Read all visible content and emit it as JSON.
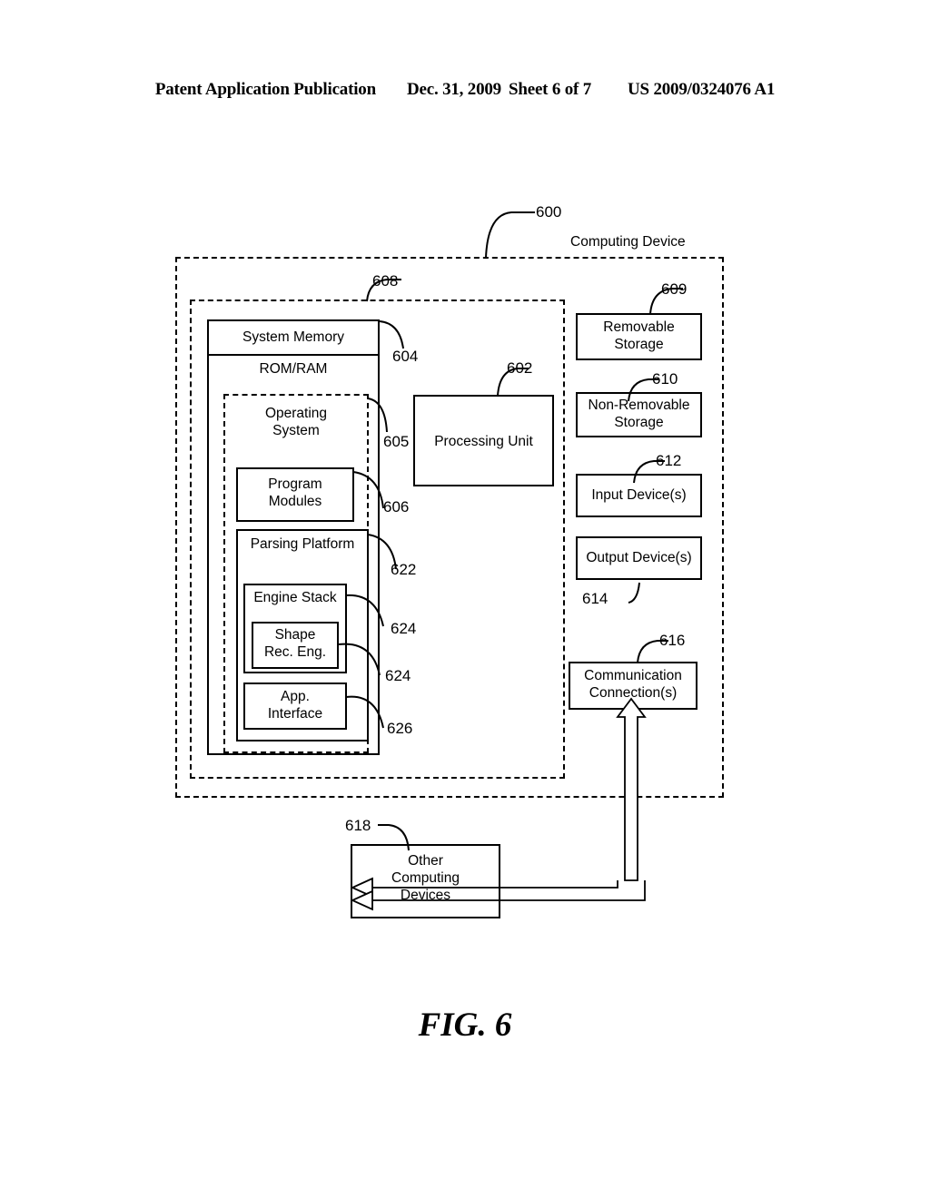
{
  "header": {
    "publication": "Patent Application Publication",
    "date": "Dec. 31, 2009",
    "sheet": "Sheet 6 of 7",
    "patent_number": "US 2009/0324076 A1"
  },
  "figure": {
    "caption": "FIG. 6",
    "outer_title": "Computing Device"
  },
  "reference_numbers": {
    "computing_device": "600",
    "processing_unit": "602",
    "system_memory": "604",
    "operating_system": "605",
    "program_modules": "606",
    "memory_region": "608",
    "removable_storage": "609",
    "non_removable_storage": "610",
    "input_devices": "612",
    "output_devices": "614",
    "communication_connections": "616",
    "other_computing_devices": "618",
    "parsing_platform": "622",
    "engine_stack": "624",
    "shape_rec_engine": "624",
    "app_interface": "626"
  },
  "blocks": {
    "system_memory": "System Memory",
    "rom_ram": "ROM/RAM",
    "operating_system": "Operating\nSystem",
    "program_modules": "Program\nModules",
    "parsing_platform": "Parsing Platform",
    "engine_stack": "Engine Stack",
    "shape_rec_engine": "Shape\nRec. Eng.",
    "app_interface": "App.\nInterface",
    "processing_unit": "Processing Unit",
    "removable_storage": "Removable\nStorage",
    "non_removable_storage": "Non-Removable\nStorage",
    "input_devices": "Input Device(s)",
    "output_devices": "Output Device(s)",
    "communication_connections": "Communication\nConnection(s)",
    "other_computing_devices": "Other\nComputing\nDevices"
  },
  "colors": {
    "ink": "#000000",
    "paper": "#ffffff"
  }
}
